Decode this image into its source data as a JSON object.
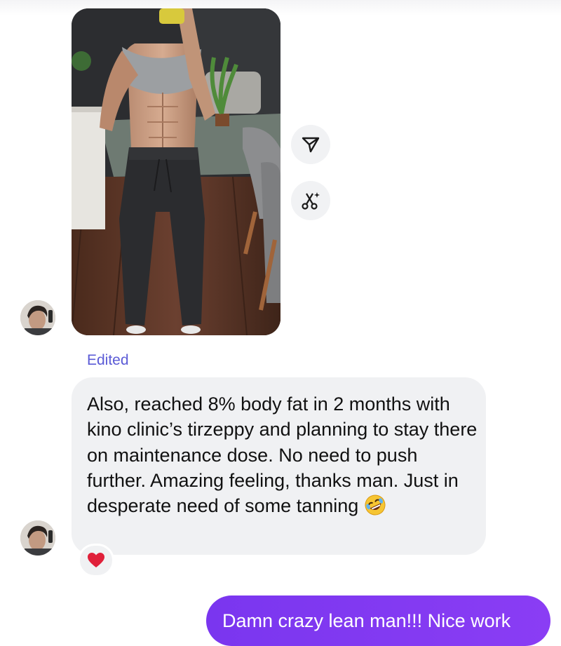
{
  "conversation": {
    "photo_message": {
      "description_icon": "photo-attachment"
    },
    "actions": {
      "share_icon": "send-icon",
      "remix_icon": "scissors-sparkle-icon"
    },
    "edited_label": "Edited",
    "incoming_text": "Also, reached 8% body fat in 2 months with kino clinic’s tirzeppy and planning to stay there on maintenance dose. No need to push further. Amazing feeling, thanks man. Just in desperate need of some tanning",
    "incoming_emoji": "rolling-on-floor-laughing-emoji",
    "reaction": "red-heart",
    "outgoing_text": "Damn crazy lean man!!! Nice work"
  },
  "colors": {
    "outgoing_bubble": "#7b36f0",
    "incoming_bubble": "#f0f1f3",
    "edited_label": "#5b5bd6",
    "reaction_heart": "#e0203a"
  }
}
